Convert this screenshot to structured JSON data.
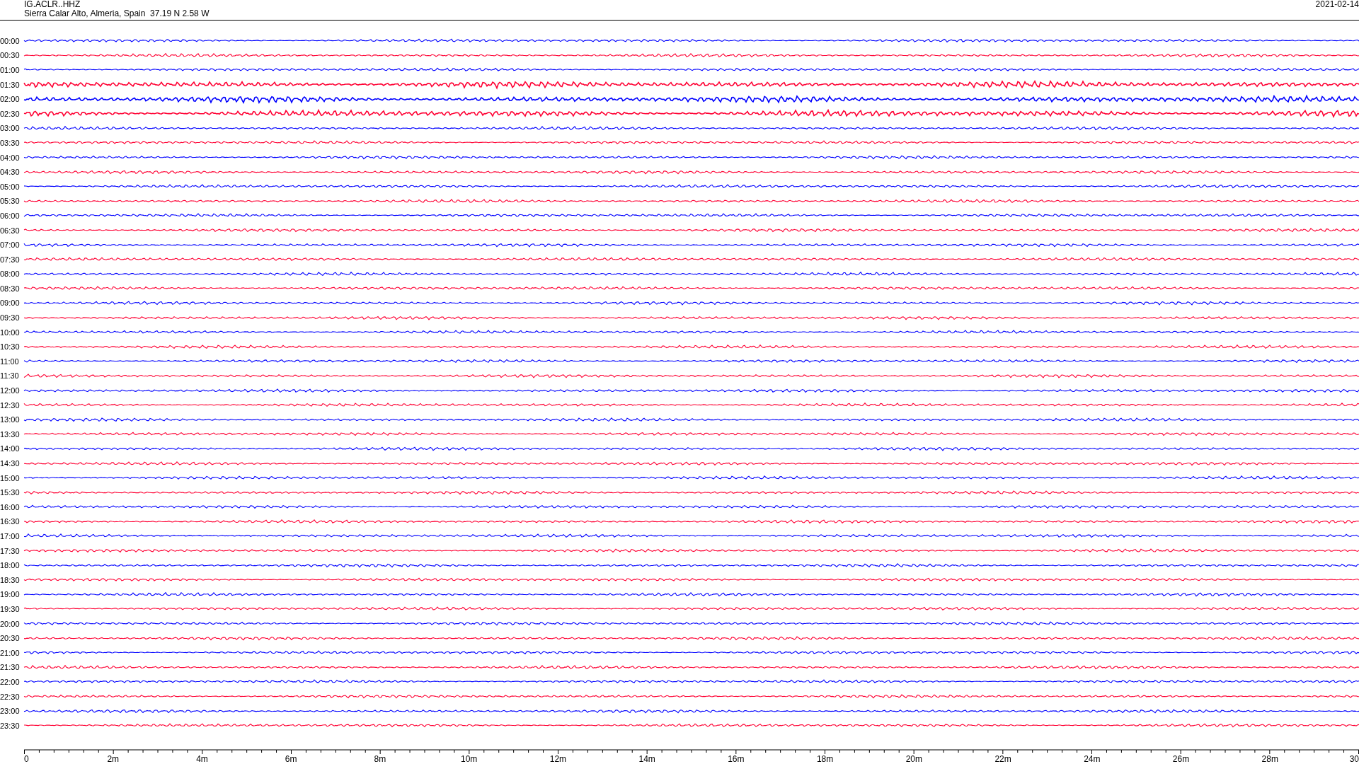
{
  "header": {
    "station": "IG.ACLR..HHZ",
    "location": "Sierra Calar Alto, Almeria, Spain  37.19 N 2.58 W",
    "date": "2021-02-14"
  },
  "rows": [
    {
      "time": "00:00",
      "color": "#0000ff",
      "kind": "quiet"
    },
    {
      "time": "00:30",
      "color": "#ff0033",
      "kind": "quiet"
    },
    {
      "time": "01:00",
      "color": "#0000ff",
      "kind": "quiet"
    },
    {
      "time": "01:30",
      "color": "#ff0033",
      "kind": "strong"
    },
    {
      "time": "02:00",
      "color": "#0000ff",
      "kind": "strong"
    },
    {
      "time": "02:30",
      "color": "#ff0033",
      "kind": "strong"
    },
    {
      "time": "03:00",
      "color": "#0000ff",
      "kind": "quiet"
    },
    {
      "time": "03:30",
      "color": "#ff0033",
      "kind": "quiet"
    },
    {
      "time": "04:00",
      "color": "#0000ff",
      "kind": "quiet"
    },
    {
      "time": "04:30",
      "color": "#ff0033",
      "kind": "quiet"
    },
    {
      "time": "05:00",
      "color": "#0000ff",
      "kind": "quiet"
    },
    {
      "time": "05:30",
      "color": "#ff0033",
      "kind": "quiet"
    },
    {
      "time": "06:00",
      "color": "#0000ff",
      "kind": "quiet"
    },
    {
      "time": "06:30",
      "color": "#ff0033",
      "kind": "quiet"
    },
    {
      "time": "07:00",
      "color": "#0000ff",
      "kind": "quiet"
    },
    {
      "time": "07:30",
      "color": "#ff0033",
      "kind": "quiet"
    },
    {
      "time": "08:00",
      "color": "#0000ff",
      "kind": "quiet"
    },
    {
      "time": "08:30",
      "color": "#ff0033",
      "kind": "quiet"
    },
    {
      "time": "09:00",
      "color": "#0000ff",
      "kind": "quiet"
    },
    {
      "time": "09:30",
      "color": "#ff0033",
      "kind": "quiet"
    },
    {
      "time": "10:00",
      "color": "#0000ff",
      "kind": "quiet"
    },
    {
      "time": "10:30",
      "color": "#ff0033",
      "kind": "quiet"
    },
    {
      "time": "11:00",
      "color": "#0000ff",
      "kind": "quiet"
    },
    {
      "time": "11:30",
      "color": "#ff0033",
      "kind": "quiet"
    },
    {
      "time": "12:00",
      "color": "#0000ff",
      "kind": "quiet"
    },
    {
      "time": "12:30",
      "color": "#ff0033",
      "kind": "quiet"
    },
    {
      "time": "13:00",
      "color": "#0000ff",
      "kind": "quiet"
    },
    {
      "time": "13:30",
      "color": "#ff0033",
      "kind": "quiet"
    },
    {
      "time": "14:00",
      "color": "#0000ff",
      "kind": "quiet"
    },
    {
      "time": "14:30",
      "color": "#ff0033",
      "kind": "quiet"
    },
    {
      "time": "15:00",
      "color": "#0000ff",
      "kind": "quiet"
    },
    {
      "time": "15:30",
      "color": "#ff0033",
      "kind": "quiet"
    },
    {
      "time": "16:00",
      "color": "#0000ff",
      "kind": "quiet"
    },
    {
      "time": "16:30",
      "color": "#ff0033",
      "kind": "quiet"
    },
    {
      "time": "17:00",
      "color": "#0000ff",
      "kind": "quiet"
    },
    {
      "time": "17:30",
      "color": "#ff0033",
      "kind": "quiet"
    },
    {
      "time": "18:00",
      "color": "#0000ff",
      "kind": "quiet"
    },
    {
      "time": "18:30",
      "color": "#ff0033",
      "kind": "quiet"
    },
    {
      "time": "19:00",
      "color": "#0000ff",
      "kind": "quiet"
    },
    {
      "time": "19:30",
      "color": "#ff0033",
      "kind": "quiet"
    },
    {
      "time": "20:00",
      "color": "#0000ff",
      "kind": "quiet"
    },
    {
      "time": "20:30",
      "color": "#ff0033",
      "kind": "quiet"
    },
    {
      "time": "21:00",
      "color": "#0000ff",
      "kind": "quiet"
    },
    {
      "time": "21:30",
      "color": "#ff0033",
      "kind": "quiet"
    },
    {
      "time": "22:00",
      "color": "#0000ff",
      "kind": "quiet"
    },
    {
      "time": "22:30",
      "color": "#ff0033",
      "kind": "quiet"
    },
    {
      "time": "23:00",
      "color": "#0000ff",
      "kind": "quiet"
    },
    {
      "time": "23:30",
      "color": "#ff0033",
      "kind": "quiet"
    }
  ],
  "axis": {
    "ticks": [
      "0",
      "2m",
      "4m",
      "6m",
      "8m",
      "10m",
      "12m",
      "14m",
      "16m",
      "18m",
      "20m",
      "22m",
      "24m",
      "26m",
      "28m",
      "30"
    ]
  }
}
